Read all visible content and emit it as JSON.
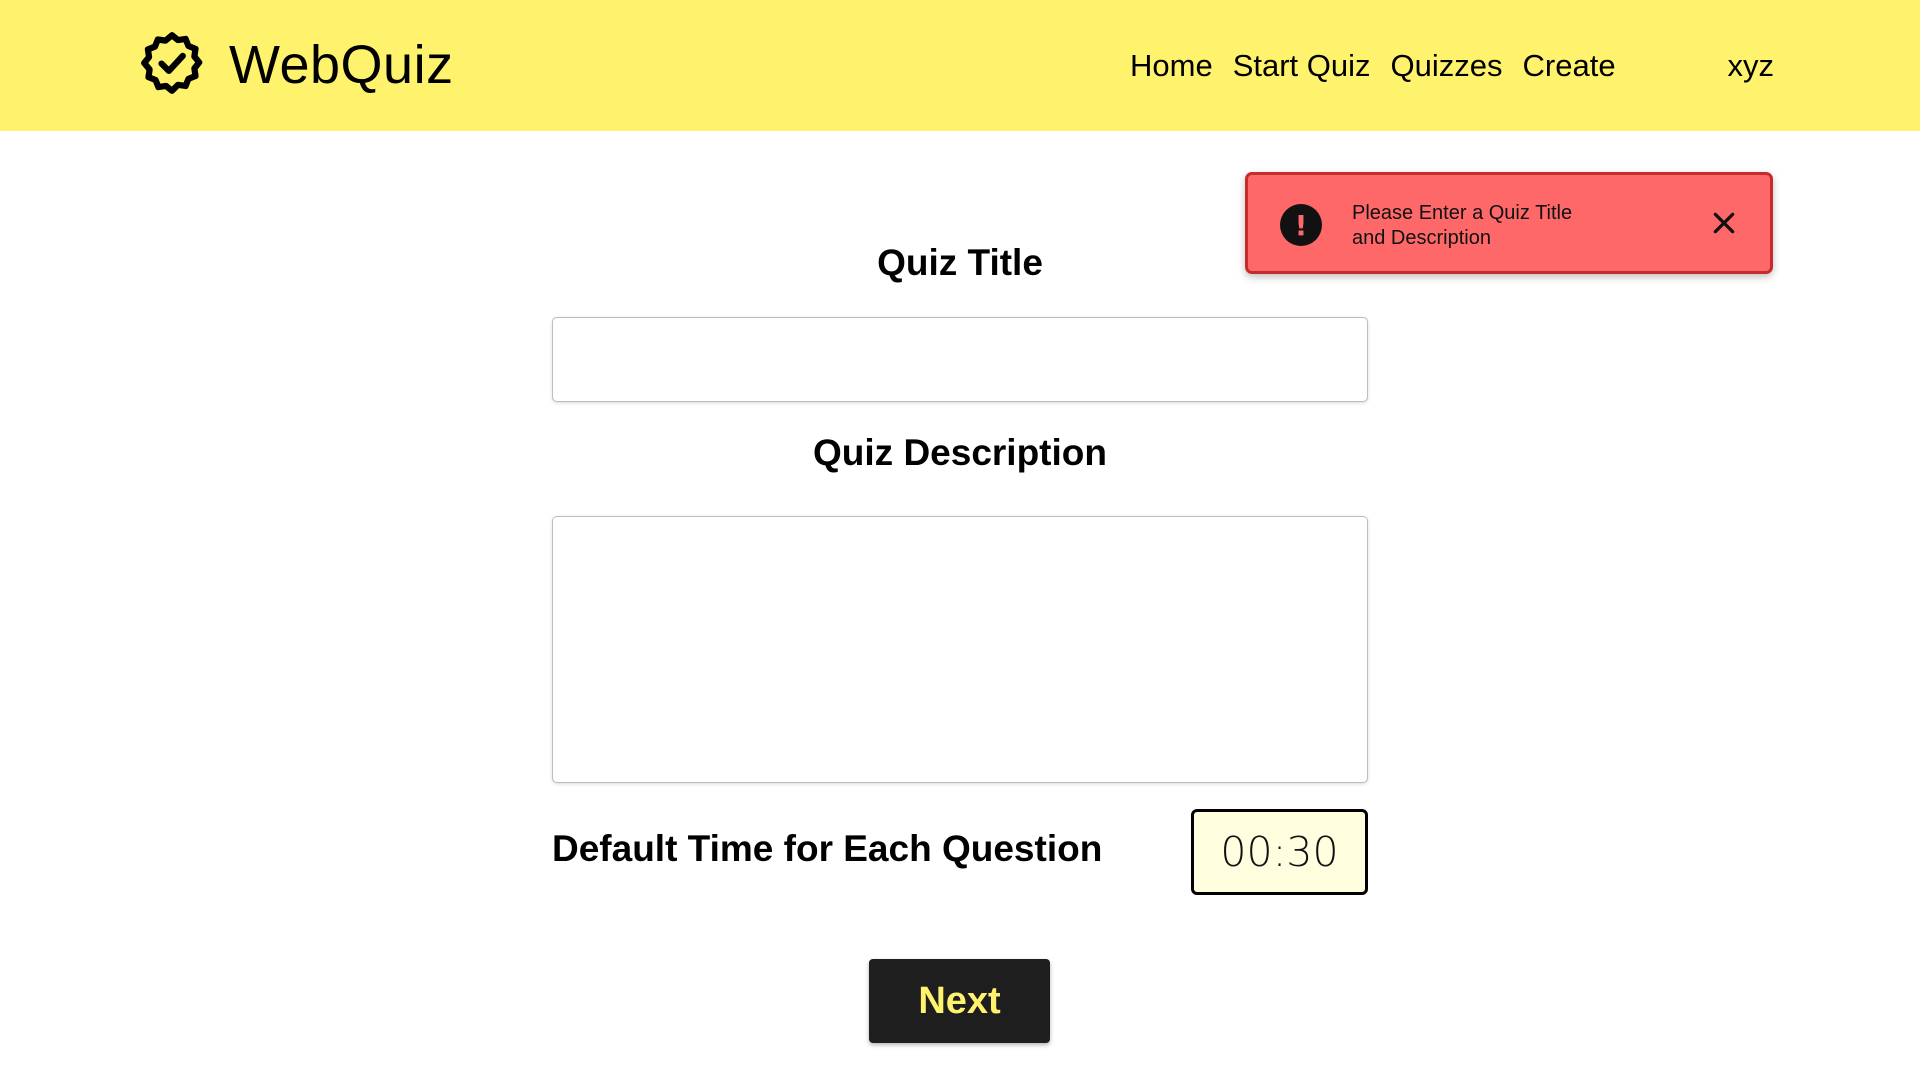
{
  "app": {
    "name": "WebQuiz",
    "logo_icon": "badge-check-icon"
  },
  "nav": {
    "items": [
      {
        "label": "Home"
      },
      {
        "label": "Start Quiz"
      },
      {
        "label": "Quizzes"
      },
      {
        "label": "Create"
      }
    ],
    "user": "xyz"
  },
  "toast": {
    "icon": "exclamation-icon",
    "message": "Please Enter a Quiz Title and Description",
    "close_icon": "close-icon",
    "background_color": "#ff6868",
    "border_color": "#c62c2c"
  },
  "form": {
    "title_label": "Quiz Title",
    "title_value": "",
    "description_label": "Quiz Description",
    "description_value": "",
    "time_label": "Default Time for Each Question",
    "time_value": "00:30",
    "next_label": "Next"
  },
  "colors": {
    "header": "#fff36e",
    "button": "#1e1e1e",
    "button_text": "#fff36e"
  }
}
